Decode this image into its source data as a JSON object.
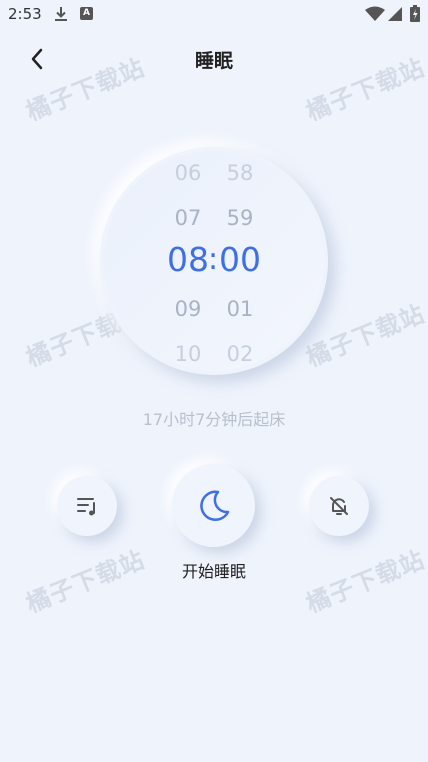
{
  "status_bar": {
    "time": "2:53",
    "badge_letter": "A"
  },
  "header": {
    "title": "睡眠"
  },
  "watermark": "橘子下载站",
  "time_picker": {
    "hour": {
      "far_above": "06",
      "above": "07",
      "selected": "08",
      "below": "09",
      "far_below": "10"
    },
    "minute": {
      "far_above": "58",
      "above": "59",
      "selected": "00",
      "below": "01",
      "far_below": "02"
    },
    "separator": ":"
  },
  "wake_info": "17小时7分钟后起床",
  "actions": {
    "start_sleep_label": "开始睡眠"
  },
  "colors": {
    "accent": "#3f6fe6",
    "background": "#eef3fc"
  }
}
